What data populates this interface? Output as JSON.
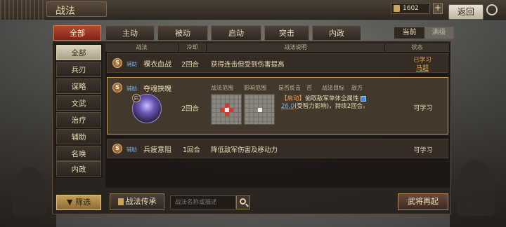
{
  "header": {
    "title": "战法",
    "currency": "1602",
    "plus_label": "+",
    "back_label": "返回"
  },
  "tabs": [
    {
      "label": "全部",
      "active": true
    },
    {
      "label": "主动",
      "active": false
    },
    {
      "label": "被动",
      "active": false
    },
    {
      "label": "启动",
      "active": false
    },
    {
      "label": "突击",
      "active": false
    },
    {
      "label": "内政",
      "active": false
    }
  ],
  "view_toggle": {
    "current": "当前",
    "full": "满级"
  },
  "sidebar": [
    {
      "label": "全部",
      "active": true
    },
    {
      "label": "兵刃",
      "active": false
    },
    {
      "label": "谋略",
      "active": false
    },
    {
      "label": "文武",
      "active": false
    },
    {
      "label": "治疗",
      "active": false
    },
    {
      "label": "辅助",
      "active": false
    },
    {
      "label": "名唤",
      "active": false
    },
    {
      "label": "内政",
      "active": false
    }
  ],
  "columns": {
    "skill": "战法",
    "cooldown": "冷却",
    "description": "战法说明",
    "status": "状态"
  },
  "rows": [
    {
      "badge": "S",
      "type": "辅助",
      "name": "裸衣血战",
      "cooldown": "2回合",
      "description": "获得连击但受到伤害提高",
      "status": "已学习",
      "learner": "马超"
    },
    {
      "badge": "S",
      "type": "辅助",
      "name": "夺魂挟魄",
      "cooldown": "2回合",
      "status": "可学习",
      "portrait_badge": "启",
      "range_labels": [
        "战法范围",
        "影响范围",
        "是否反击",
        "否",
        "战法目标",
        "敌方"
      ],
      "effect": {
        "tag": "【启动】",
        "text1": "偷取敌军单体全属性",
        "value": "26.0",
        "text2": "(受智力影响)，持续2回合。"
      }
    },
    {
      "badge": "S",
      "type": "辅助",
      "name": "兵疲意阻",
      "cooldown": "1回合",
      "description": "降低敌军伤害及移动力",
      "status": "可学习"
    }
  ],
  "bottom": {
    "filter_label": "筛选",
    "inherit_label": "战法传承",
    "search_placeholder": "战法名称或描述",
    "respec_label": "武将再起"
  },
  "colors": {
    "accent": "#b5492f",
    "gold": "#c6a05a",
    "highlight": "#e6a24a",
    "blue": "#6bb0e8"
  }
}
